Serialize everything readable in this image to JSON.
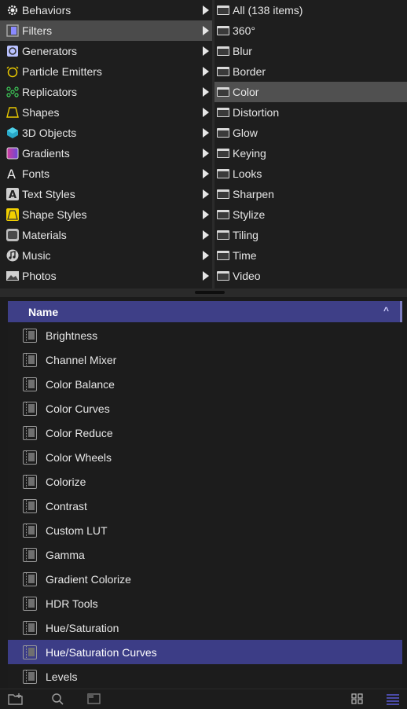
{
  "categories": [
    {
      "label": "Behaviors",
      "icon": "gear-icon"
    },
    {
      "label": "Filters",
      "icon": "filmstrip-icon",
      "selected": true
    },
    {
      "label": "Generators",
      "icon": "generator-icon"
    },
    {
      "label": "Particle Emitters",
      "icon": "alarm-clock-icon"
    },
    {
      "label": "Replicators",
      "icon": "replicator-dots-icon"
    },
    {
      "label": "Shapes",
      "icon": "shape-outline-icon"
    },
    {
      "label": "3D Objects",
      "icon": "cube-icon"
    },
    {
      "label": "Gradients",
      "icon": "gradient-icon"
    },
    {
      "label": "Fonts",
      "icon": "font-a-icon"
    },
    {
      "label": "Text Styles",
      "icon": "text-style-a-icon"
    },
    {
      "label": "Shape Styles",
      "icon": "shape-style-icon"
    },
    {
      "label": "Materials",
      "icon": "materials-icon"
    },
    {
      "label": "Music",
      "icon": "music-note-icon"
    },
    {
      "label": "Photos",
      "icon": "photo-icon"
    }
  ],
  "subcategories": [
    {
      "label": "All (138 items)"
    },
    {
      "label": "360°"
    },
    {
      "label": "Blur"
    },
    {
      "label": "Border"
    },
    {
      "label": "Color",
      "selected": true
    },
    {
      "label": "Distortion"
    },
    {
      "label": "Glow"
    },
    {
      "label": "Keying"
    },
    {
      "label": "Looks"
    },
    {
      "label": "Sharpen"
    },
    {
      "label": "Stylize"
    },
    {
      "label": "Tiling"
    },
    {
      "label": "Time"
    },
    {
      "label": "Video"
    }
  ],
  "list": {
    "header": "Name",
    "sort_indicator": "^",
    "items": [
      {
        "label": "Brightness"
      },
      {
        "label": "Channel Mixer"
      },
      {
        "label": "Color Balance"
      },
      {
        "label": "Color Curves"
      },
      {
        "label": "Color Reduce"
      },
      {
        "label": "Color Wheels"
      },
      {
        "label": "Colorize"
      },
      {
        "label": "Contrast"
      },
      {
        "label": "Custom LUT"
      },
      {
        "label": "Gamma"
      },
      {
        "label": "Gradient Colorize"
      },
      {
        "label": "HDR Tools"
      },
      {
        "label": "Hue/Saturation"
      },
      {
        "label": "Hue/Saturation Curves",
        "selected": true
      },
      {
        "label": "Levels"
      }
    ]
  },
  "colors": {
    "selection": "#3c3d86",
    "accent": "#5b5bd6"
  },
  "toolbar": {
    "icons": [
      "new-folder-icon",
      "search-icon",
      "preview-icon",
      "grid-view-icon",
      "list-view-icon"
    ]
  }
}
